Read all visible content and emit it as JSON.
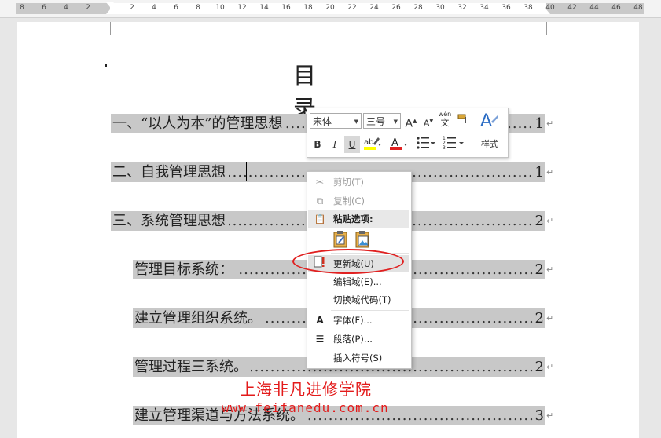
{
  "ruler": {
    "labels": [
      "8",
      "6",
      "4",
      "2",
      "2",
      "4",
      "6",
      "8",
      "10",
      "12",
      "14",
      "16",
      "18",
      "20",
      "22",
      "24",
      "26",
      "28",
      "30",
      "32",
      "34",
      "36",
      "38",
      "40",
      "42",
      "44",
      "46",
      "48"
    ]
  },
  "document": {
    "title": "目　录",
    "toc": [
      {
        "text": "一、“以人为本”的管理思想",
        "page": "1"
      },
      {
        "text": "二、自我管理思想",
        "page": "1"
      },
      {
        "text": "三、系统管理思想",
        "page": "2"
      },
      {
        "text": "管理目标系统：",
        "page": "2"
      },
      {
        "text": "建立管理组织系统。",
        "page": "2"
      },
      {
        "text": "管理过程三系统。",
        "page": "2"
      },
      {
        "text": "建立管理渠道与方法系统。",
        "page": "3"
      }
    ],
    "return_mark": "↵"
  },
  "mini_toolbar": {
    "font_name": "宋体",
    "font_size": "三号",
    "grow_font": "A",
    "shrink_font": "A",
    "phonetic": "wén",
    "phonetic_char": "文",
    "bold": "B",
    "italic": "I",
    "underline": "U",
    "font_color": "A",
    "styles_label": "样式"
  },
  "context_menu": {
    "items": [
      {
        "label": "剪切(T)",
        "icon": "scissors-icon",
        "disabled": true
      },
      {
        "label": "复制(C)",
        "icon": "copy-icon",
        "disabled": true
      },
      {
        "label": "粘贴选项:",
        "icon": "paste-icon",
        "header": true
      },
      {
        "label": "更新域(U)",
        "icon": "update-field-icon",
        "highlighted": true
      },
      {
        "label": "编辑域(E)...",
        "icon": ""
      },
      {
        "label": "切换域代码(T)",
        "icon": ""
      },
      {
        "label": "字体(F)...",
        "icon": "font-icon"
      },
      {
        "label": "段落(P)...",
        "icon": "paragraph-icon"
      },
      {
        "label": "插入符号(S)",
        "icon": ""
      }
    ]
  },
  "watermark": {
    "line1": "上海非凡进修学院",
    "line2": "www.feifanedu.com.cn"
  },
  "colors": {
    "selection": "#c8c8c8",
    "oval": "#e02020",
    "watermark": "#e31a1a"
  }
}
